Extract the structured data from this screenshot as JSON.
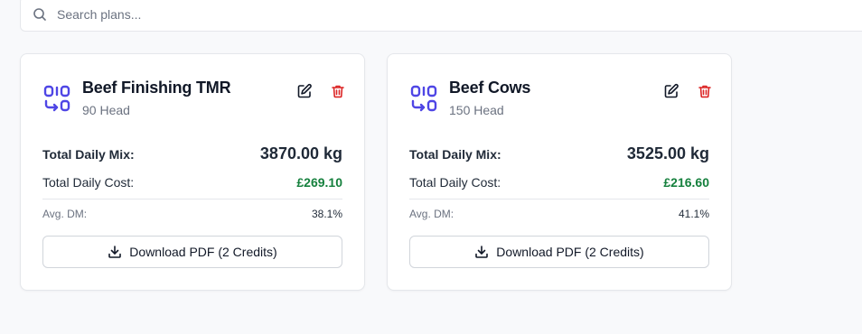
{
  "search": {
    "placeholder": "Search plans..."
  },
  "colors": {
    "accent": "#4f46e5",
    "cost": "#15803d",
    "danger": "#dc2626"
  },
  "plans": [
    {
      "title": "Beef Finishing TMR",
      "subtitle": "90 Head",
      "total_daily_mix_label": "Total Daily Mix:",
      "total_daily_mix": "3870.00 kg",
      "total_daily_cost_label": "Total Daily Cost:",
      "total_daily_cost": "£269.10",
      "avg_dm_label": "Avg. DM:",
      "avg_dm": "38.1%",
      "download_label": "Download PDF (2 Credits)",
      "icon": "rations-icon"
    },
    {
      "title": "Beef Cows",
      "subtitle": "150 Head",
      "total_daily_mix_label": "Total Daily Mix:",
      "total_daily_mix": "3525.00 kg",
      "total_daily_cost_label": "Total Daily Cost:",
      "total_daily_cost": "£216.60",
      "avg_dm_label": "Avg. DM:",
      "avg_dm": "41.1%",
      "download_label": "Download PDF (2 Credits)",
      "icon": "rations-icon"
    }
  ]
}
